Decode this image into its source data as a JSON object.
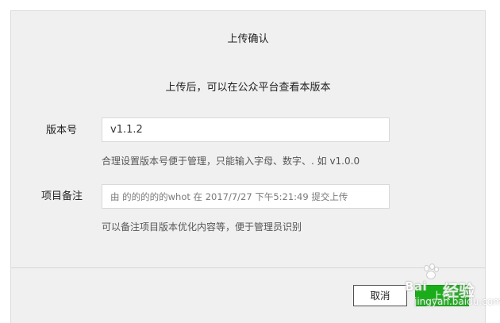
{
  "dialog": {
    "title": "上传确认",
    "subtitle": "上传后，可以在公众平台查看本版本",
    "version": {
      "label": "版本号",
      "value": "v1.1.2",
      "hint": "合理设置版本号便于管理，只能输入字母、数字、. 如 v1.0.0"
    },
    "note": {
      "label": "项目备注",
      "value": "由 的的的的的whot 在 2017/7/27 下午5:21:49 提交上传",
      "hint": "可以备注项目版本优化内容等，便于管理员识别"
    },
    "buttons": {
      "cancel": "取消",
      "upload": "上传"
    }
  },
  "colors": {
    "primary": "#1aad19",
    "dialog_bg": "#f0f0f0"
  },
  "watermark": {
    "brand": "Bai",
    "brand_cn": "经验",
    "url": "jingyan.baidu.com"
  }
}
